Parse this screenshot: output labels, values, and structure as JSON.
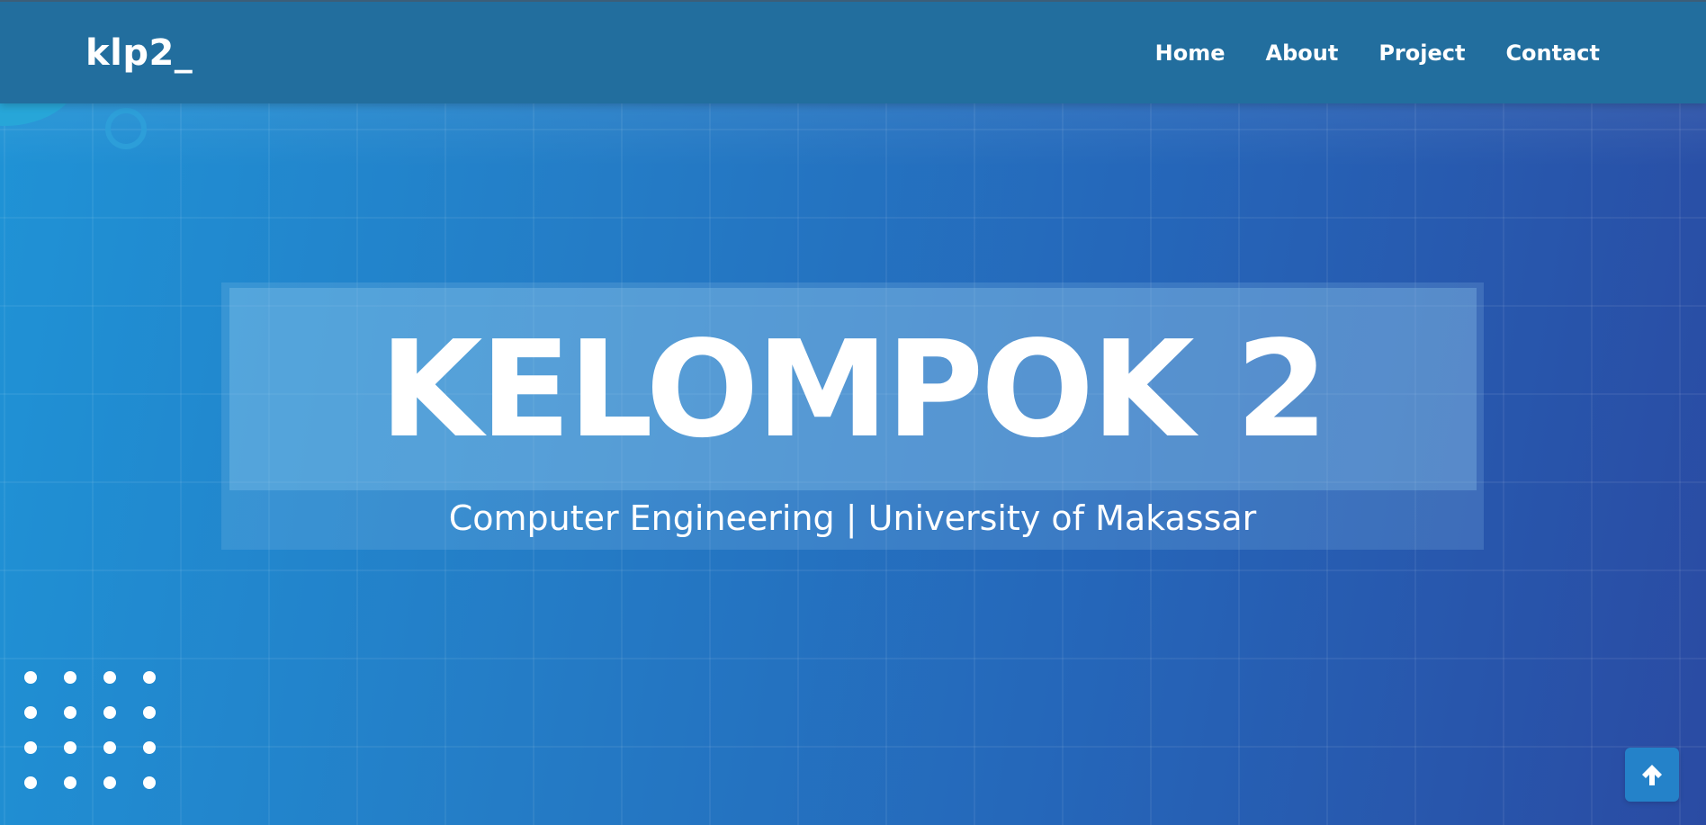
{
  "navbar": {
    "logo": "klp2_",
    "links": [
      {
        "label": "Home"
      },
      {
        "label": "About"
      },
      {
        "label": "Project"
      },
      {
        "label": "Contact"
      }
    ]
  },
  "hero": {
    "title": "KELOMPOK 2",
    "subtitle": "Computer Engineering | University of Makassar"
  },
  "back_to_top": {
    "icon": "arrow-up-icon"
  },
  "colors": {
    "navbar_bg": "#226e9e",
    "hero_gradient_start": "#1f93d6",
    "hero_gradient_end": "#2a4ba3",
    "accent": "#2482c9",
    "text": "#ffffff"
  }
}
